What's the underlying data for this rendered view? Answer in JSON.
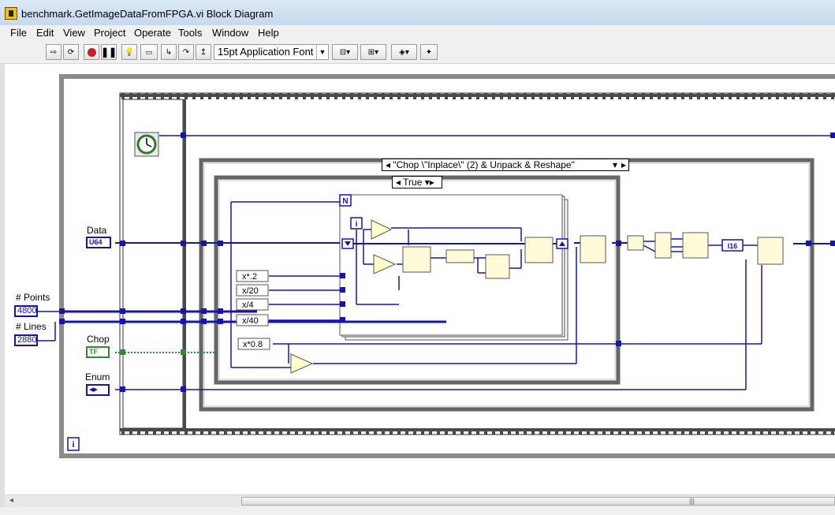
{
  "window": {
    "title": "benchmark.GetImageDataFromFPGA.vi Block Diagram"
  },
  "menu": {
    "items": [
      "File",
      "Edit",
      "View",
      "Project",
      "Operate",
      "Tools",
      "Window",
      "Help"
    ]
  },
  "toolbar": {
    "font": "15pt Application Font"
  },
  "diagram": {
    "case_outer": "\"Chop \\\"Inplace\\\" (2) & Unpack & Reshape\"",
    "case_inner": "True",
    "terminals": {
      "data_label": "Data",
      "data_type": "U64",
      "points_label": "# Points",
      "points_value": "4800",
      "lines_label": "# Lines",
      "lines_value": "2880",
      "chop_label": "Chop",
      "chop_type": "TF",
      "enum_label": "Enum"
    },
    "expressions": [
      "x*.2",
      "x/20",
      "x/4",
      "x/40",
      "x*0.8"
    ],
    "loop_count": "N",
    "loop_index": "i",
    "type_cast": "I16",
    "info_icon": "i"
  },
  "colors": {
    "wire_int": "#1414b4",
    "wire_bool": "#2f8c2f",
    "structure": "#8c8c8c",
    "title_bg": "#dce9f6"
  }
}
